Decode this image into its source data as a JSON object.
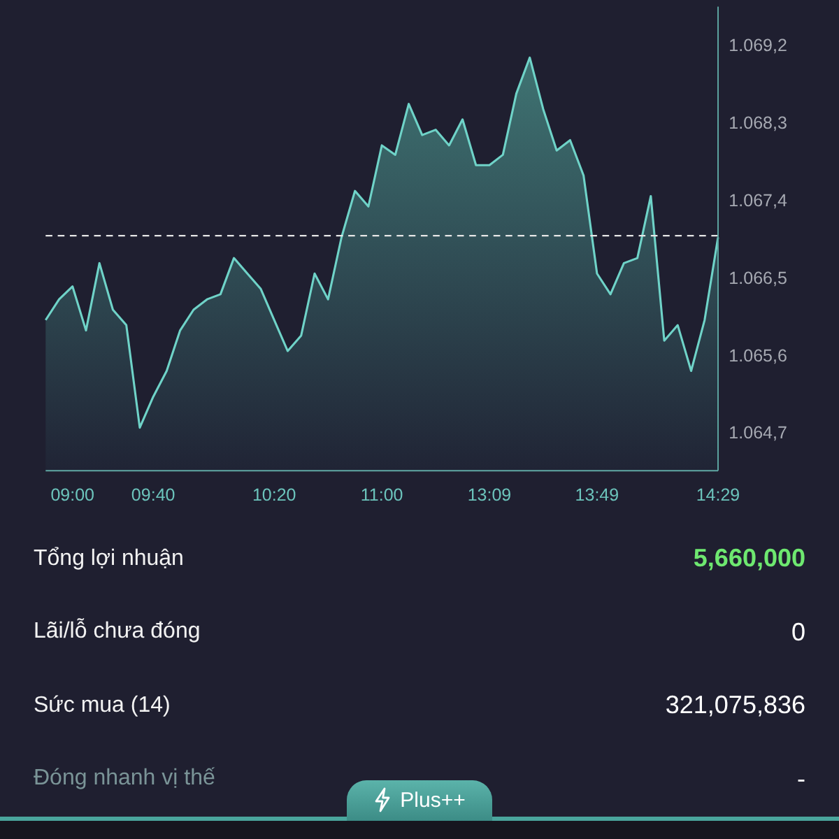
{
  "chart": {
    "chart_data": {
      "type": "area",
      "categories": [
        null,
        null,
        "09:00",
        null,
        null,
        null,
        null,
        null,
        "09:40",
        null,
        null,
        null,
        null,
        null,
        null,
        null,
        null,
        "10:20",
        null,
        null,
        null,
        null,
        null,
        null,
        null,
        "11:00",
        null,
        null,
        null,
        null,
        null,
        null,
        null,
        "13:09",
        null,
        null,
        null,
        null,
        null,
        null,
        null,
        "13:49",
        null,
        null,
        null,
        null,
        null,
        null,
        null,
        null,
        "14:29"
      ],
      "series": [
        {
          "color": "#6fd3c8",
          "values": [
            1066.0,
            1066.24,
            1066.39,
            1065.88,
            1066.66,
            1066.12,
            1065.94,
            1064.75,
            1065.11,
            1065.41,
            1065.88,
            1066.12,
            1066.24,
            1066.3,
            1066.72,
            1066.54,
            1066.36,
            1066.0,
            1065.64,
            1065.82,
            1066.54,
            1066.24,
            1066.96,
            1067.5,
            1067.32,
            1068.03,
            1067.92,
            1068.51,
            1068.15,
            1068.21,
            1068.03,
            1068.33,
            1067.8,
            1067.8,
            1067.92,
            1068.63,
            1069.05,
            1068.45,
            1067.97,
            1068.09,
            1067.68,
            1066.54,
            1066.3,
            1066.66,
            1066.72,
            1067.44,
            1065.76,
            1065.94,
            1065.41,
            1066.0,
            1066.96
          ]
        }
      ],
      "ylim": [
        1064.25,
        1069.64
      ],
      "yticks": [
        {
          "value": 1064.7,
          "label": "1.064,7"
        },
        {
          "value": 1065.6,
          "label": "1.065,6"
        },
        {
          "value": 1066.5,
          "label": "1.066,5"
        },
        {
          "value": 1067.4,
          "label": "1.067,4"
        },
        {
          "value": 1068.3,
          "label": "1.068,3"
        },
        {
          "value": 1069.2,
          "label": "1.069,2"
        }
      ],
      "ref_lines": [
        {
          "axis": "y",
          "value": 1066.98
        }
      ]
    }
  },
  "stats": [
    {
      "label": "Tổng lợi nhuận",
      "value": "5,660,000",
      "color": "#6ee870",
      "disabled": false
    },
    {
      "label": "Lãi/lỗ chưa đóng",
      "value": "0",
      "color": "#ffffff",
      "disabled": false
    },
    {
      "label": "Sức mua (14)",
      "value": "321,075,836",
      "color": "#ffffff",
      "disabled": false
    },
    {
      "label": "Đóng nhanh vị thế",
      "value": "-",
      "color": "#ffffff",
      "disabled": true
    }
  ],
  "plus_tab": {
    "label": "Plus++"
  }
}
